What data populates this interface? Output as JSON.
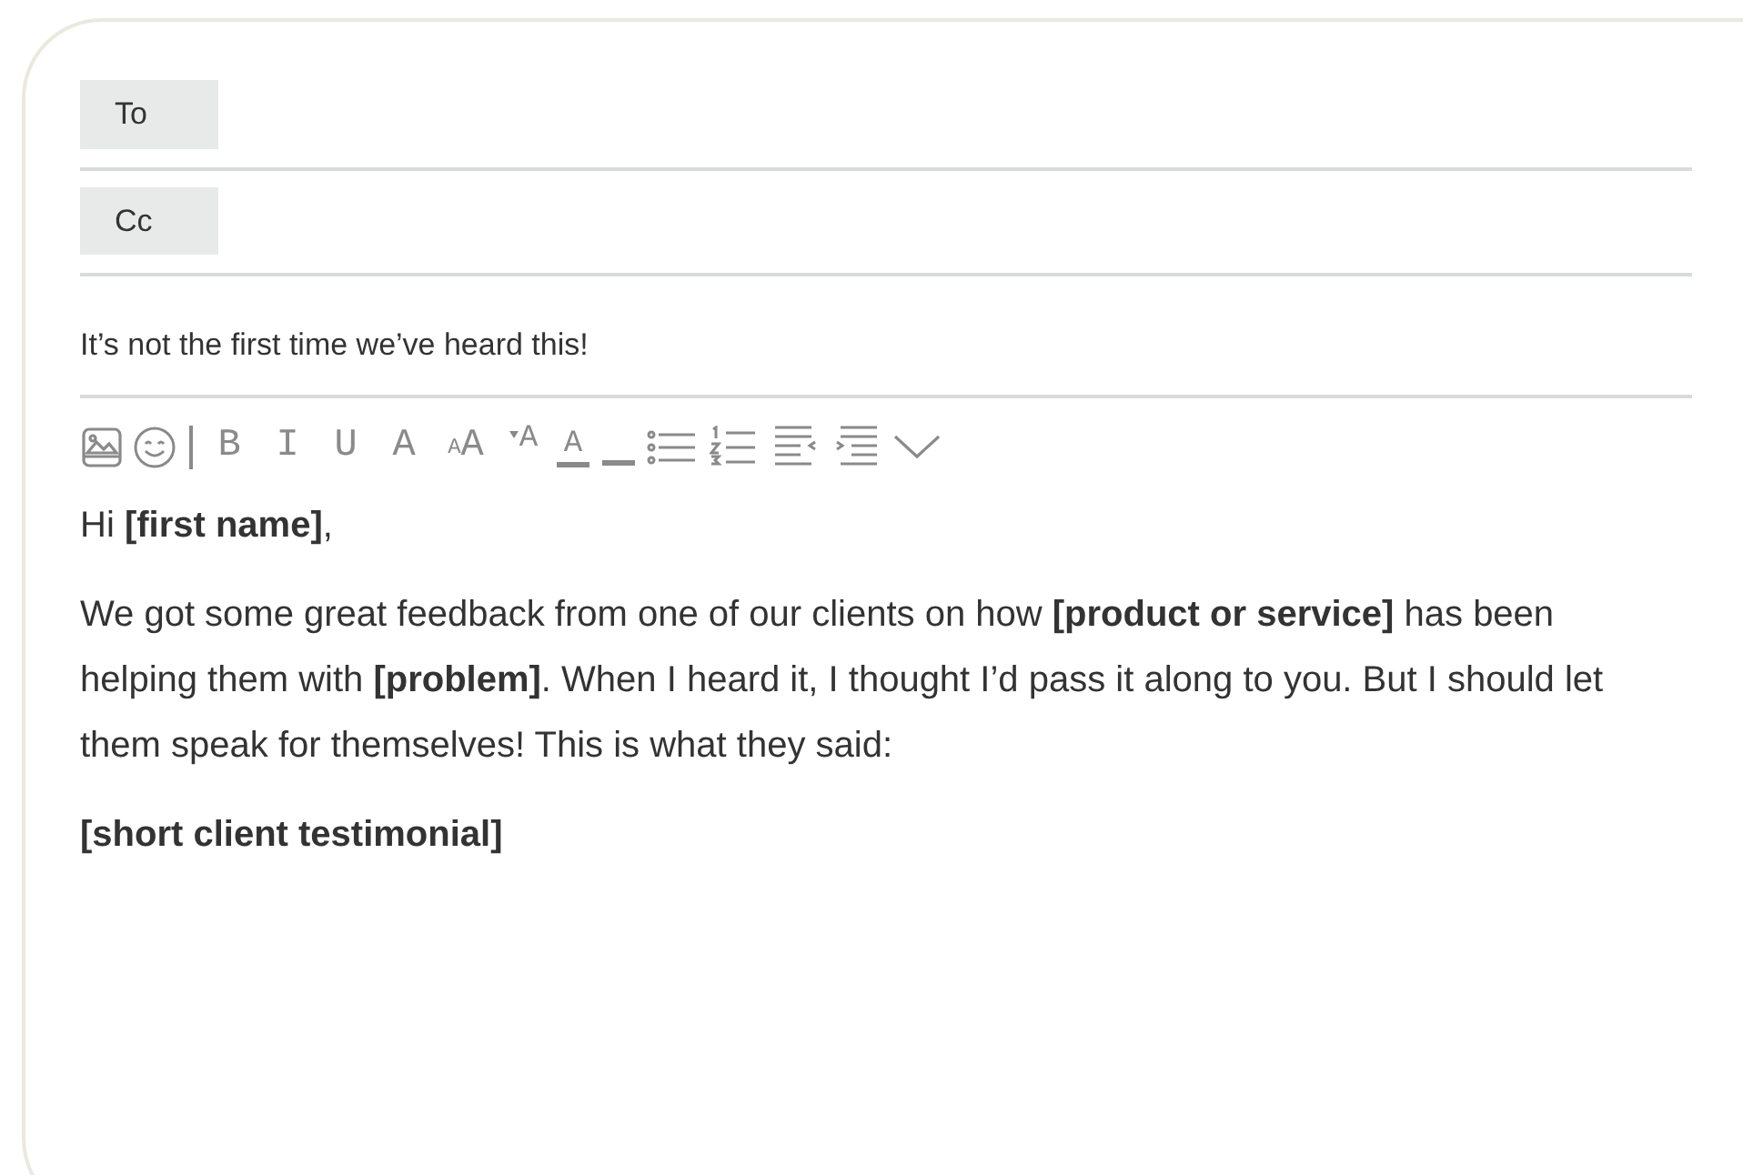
{
  "fields": [
    {
      "label": "To"
    },
    {
      "label": "Cc"
    }
  ],
  "subject": "It’s not the first time we’ve heard this!",
  "toolbar": [
    {
      "kind": "image"
    },
    {
      "kind": "emoji"
    },
    {
      "kind": "divider"
    },
    {
      "kind": "glyph",
      "label": "B"
    },
    {
      "kind": "glyph",
      "label": "I"
    },
    {
      "kind": "glyph",
      "label": "U"
    },
    {
      "kind": "glyph",
      "label": "A"
    },
    {
      "kind": "size",
      "small": "A",
      "large": "A"
    },
    {
      "kind": "raise",
      "label": "A"
    },
    {
      "kind": "color",
      "label": "A"
    },
    {
      "kind": "highlight"
    },
    {
      "kind": "bullets"
    },
    {
      "kind": "numbers"
    },
    {
      "kind": "outdent"
    },
    {
      "kind": "indent"
    },
    {
      "kind": "more"
    }
  ],
  "body": [
    "Hi **[first name]**,",
    "We got some great feedback from one of our clients on how **[product or service]** has been helping them with **[problem]**. When I heard it, I thought I’d pass it along to you. But I should let them speak for themselves! This is what they said:",
    "**[short client testimonial]**"
  ]
}
